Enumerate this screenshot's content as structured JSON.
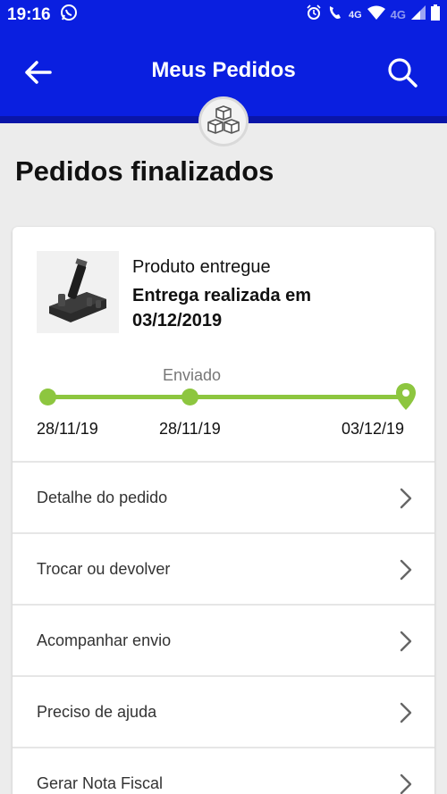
{
  "status_bar": {
    "time": "19:16",
    "network_label_1": "4G",
    "network_label_2": "4G"
  },
  "header": {
    "title": "Meus Pedidos",
    "back_icon": "arrow-left-icon",
    "search_icon": "search-icon",
    "badge_icon": "boxes-icon",
    "color": "#0a1fe0"
  },
  "section_title": "Pedidos finalizados",
  "order": {
    "status_label": "Produto entregue",
    "status_detail": "Entrega realizada em 03/12/2019",
    "timeline": {
      "caption": "Enviado",
      "dates": [
        "28/11/19",
        "28/11/19",
        "03/12/19"
      ],
      "color": "#8dc63f"
    },
    "actions": [
      {
        "label": "Detalhe do pedido"
      },
      {
        "label": "Trocar ou devolver"
      },
      {
        "label": "Acompanhar envio"
      },
      {
        "label": "Preciso de ajuda"
      },
      {
        "label": "Gerar Nota Fiscal"
      }
    ]
  }
}
